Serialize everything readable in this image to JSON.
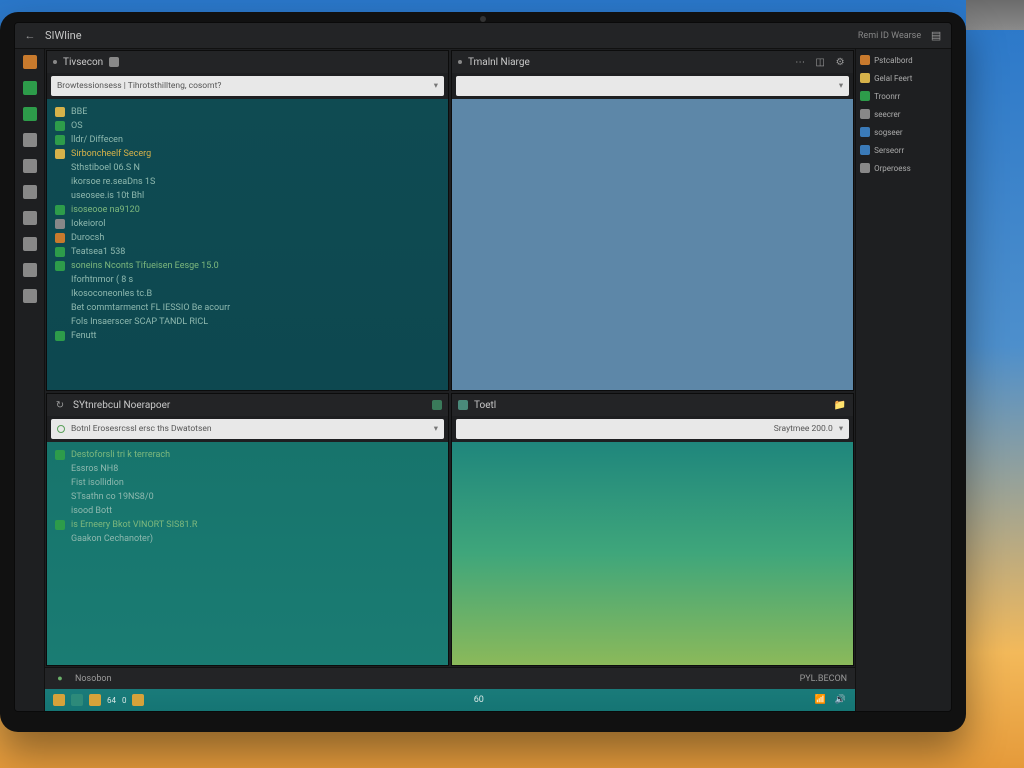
{
  "titlebar": {
    "app_name": "SIWline",
    "right_label": "Remi ID Wearse"
  },
  "activity_icons": [
    "#c87a2d",
    "#2d9c4a",
    "#2d9c4a",
    "#888",
    "#888",
    "#888",
    "#888",
    "#888",
    "#888",
    "#888"
  ],
  "panes": {
    "tl": {
      "tab": "Tivsecon",
      "addr": "Browtessionsess | Tihrotsthillteng, cosomt?",
      "lines": [
        {
          "ico": "#d6b24a",
          "t": "BBE"
        },
        {
          "ico": "#2d9c4a",
          "t": "OS"
        },
        {
          "ico": "#2d9c4a",
          "t": "lldr/ Diffecen"
        },
        {
          "ico": "#d6b24a",
          "t": "Sirboncheelf  Secerg",
          "cls": "kw"
        },
        {
          "ico": "",
          "t": "Sthstiboel  06.S N"
        },
        {
          "ico": "",
          "t": "ikorsoe  re.seaDns 1S"
        },
        {
          "ico": "",
          "t": "useosee.is 10t Bhl"
        },
        {
          "ico": "#2d9c4a",
          "t": "isoseooe na9120",
          "cls": "str"
        },
        {
          "ico": "#888",
          "t": "Iokeiorol"
        },
        {
          "ico": "#c87a2d",
          "t": "Durocsh"
        },
        {
          "ico": "#2d9c4a",
          "t": "Teatsea1 538"
        },
        {
          "ico": "#2d9c4a",
          "t": "soneins Nconts Tifueisen Eesge 15.0",
          "cls": "str"
        },
        {
          "ico": "",
          "t": "Iforhtnmor ( 8  s"
        },
        {
          "ico": "",
          "t": "Ikosoconeonles tc.B"
        },
        {
          "ico": "",
          "t": "Bet commtarmenct FL IESSIO Be acourr"
        },
        {
          "ico": "",
          "t": "Fols Insaerscer SCAP TANDL RICL"
        },
        {
          "ico": "#2d9c4a",
          "t": "Fenutt"
        }
      ]
    },
    "tr": {
      "tab": "Tmalnl Niarge"
    },
    "bl": {
      "tab": "SYtnrebcul  Noerapoer",
      "addr": "Botnl Erosesrcssl ersc ths Dwatotsen",
      "lines": [
        {
          "ico": "#2d9c4a",
          "t": "Destoforsli tri k terrerach",
          "cls": "str"
        },
        {
          "ico": "",
          "t": "Essros NH8"
        },
        {
          "ico": "",
          "t": "Fist isollidion"
        },
        {
          "ico": "",
          "t": "STsathn co  19NS8/0"
        },
        {
          "ico": "",
          "t": "isood Bott"
        },
        {
          "ico": "#2d9c4a",
          "t": "is Erneery Bkot  VINORT SIS81.R",
          "cls": "str"
        },
        {
          "ico": "",
          "t": "Gaakon Cechanoter)"
        }
      ]
    },
    "br": {
      "tab": "Toetl",
      "addr_right": "Sraytmee  200.0"
    }
  },
  "rightpanel": [
    {
      "c": "#c87a2d",
      "t": "Pstcalbord"
    },
    {
      "c": "#d6b24a",
      "t": "Gelal Feert"
    },
    {
      "c": "#2d9c4a",
      "t": "Troonrr"
    },
    {
      "c": "#888",
      "t": "seecrer"
    },
    {
      "c": "#3a7ab8",
      "t": "sogseer"
    },
    {
      "c": "#3a7ab8",
      "t": "Serseorr"
    },
    {
      "c": "#888",
      "t": "Orperoess"
    }
  ],
  "statusbar": {
    "left": "Nosobon",
    "right": "PYL.BECON"
  },
  "taskbar": {
    "center": "60",
    "labels": [
      "",
      ""
    ]
  }
}
